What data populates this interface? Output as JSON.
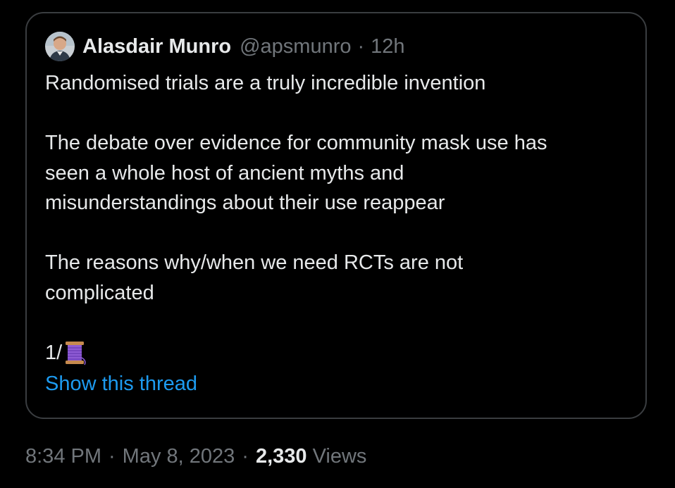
{
  "quoted_tweet": {
    "author": {
      "name": "Alasdair Munro",
      "handle": "@apsmunro",
      "separator": "·",
      "time": "12h"
    },
    "paragraphs": [
      [
        "Randomised trials are a truly incredible invention"
      ],
      [
        "The debate over evidence for community mask use has",
        "seen a whole host of ancient myths and",
        "misunderstandings about their use reappear"
      ],
      [
        "The reasons why/when we need RCTs are not",
        "complicated"
      ]
    ],
    "thread_marker": "1/",
    "thread_icon": "spool-of-thread-icon",
    "show_thread_label": "Show this thread"
  },
  "meta": {
    "time": "8:34 PM",
    "separator": "·",
    "date": "May 8, 2023",
    "views_count": "2,330",
    "views_label": "Views"
  },
  "colors": {
    "background": "#000000",
    "border": "#3a3d40",
    "text_primary": "#e7e9ea",
    "text_secondary": "#71767b",
    "link": "#1d9bf0"
  }
}
